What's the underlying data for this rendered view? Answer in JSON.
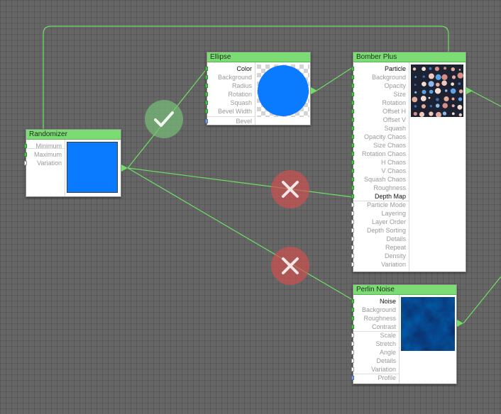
{
  "colors": {
    "wire": "#6ede64",
    "title_bar": "#7cdc74",
    "swatch_blue": "#0a7bff",
    "ok_badge": "#78be78",
    "reject_badge": "#d25050"
  },
  "nodes": {
    "randomizer": {
      "title": "Randomizer",
      "params": [
        "Minimum",
        "Maximum",
        "Variation"
      ]
    },
    "ellipse": {
      "title": "Ellipse",
      "params": [
        "Color",
        "Background",
        "Radius",
        "Rotation",
        "Squash",
        "Bevel Width",
        "Bevel"
      ]
    },
    "bomber_plus": {
      "title": "Bomber Plus",
      "params": [
        "Particle",
        "Background",
        "Opacity",
        "Size",
        "Rotation",
        "Offset H",
        "Offset V",
        "Squash",
        "Opacity Chaos",
        "Size Chaos",
        "Rotation Chaos",
        "H Chaos",
        "V Chaos",
        "Squash Chaos",
        "Roughness",
        "Depth Map",
        "Particle Mode",
        "Layering",
        "Layer Order",
        "Depth Sorting",
        "Details",
        "Repeat",
        "Density",
        "Variation"
      ]
    },
    "perlin_noise": {
      "title": "Perlin Noise",
      "params": [
        "Noise",
        "Background",
        "Roughness",
        "Contrast",
        "Scale",
        "Stretch",
        "Angle",
        "Details",
        "Variation",
        "Profile"
      ]
    }
  },
  "badges": [
    {
      "name": "check-icon",
      "state": "accepted"
    },
    {
      "name": "x-icon",
      "state": "rejected"
    },
    {
      "name": "x-icon",
      "state": "rejected"
    }
  ]
}
